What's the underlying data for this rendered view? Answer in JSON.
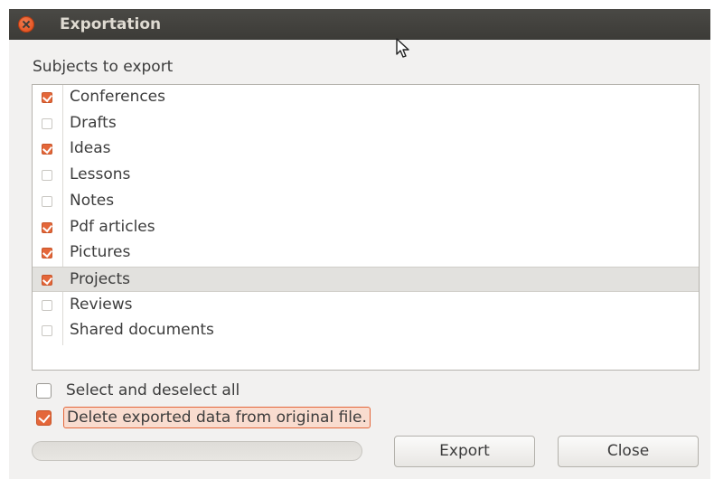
{
  "window": {
    "title": "Exportation"
  },
  "section": {
    "label": "Subjects to export"
  },
  "subjects": [
    {
      "label": "Conferences",
      "checked": true
    },
    {
      "label": "Drafts",
      "checked": false
    },
    {
      "label": "Ideas",
      "checked": true
    },
    {
      "label": "Lessons",
      "checked": false
    },
    {
      "label": "Notes",
      "checked": false
    },
    {
      "label": "Pdf articles",
      "checked": true
    },
    {
      "label": "Pictures",
      "checked": true
    },
    {
      "label": "Projects",
      "checked": true,
      "selected": true
    },
    {
      "label": "Reviews",
      "checked": false
    },
    {
      "label": "Shared documents",
      "checked": false
    }
  ],
  "options": {
    "select_all": {
      "label": "Select and deselect all",
      "checked": false
    },
    "delete_exported": {
      "label": "Delete exported data from original file.",
      "checked": true
    }
  },
  "progress": {
    "value": 0
  },
  "buttons": {
    "export_label": "Export",
    "close_label": "Close"
  },
  "colors": {
    "accent": "#e4673a",
    "titlebar": "#3c3b37",
    "background": "#f2f1f0"
  }
}
